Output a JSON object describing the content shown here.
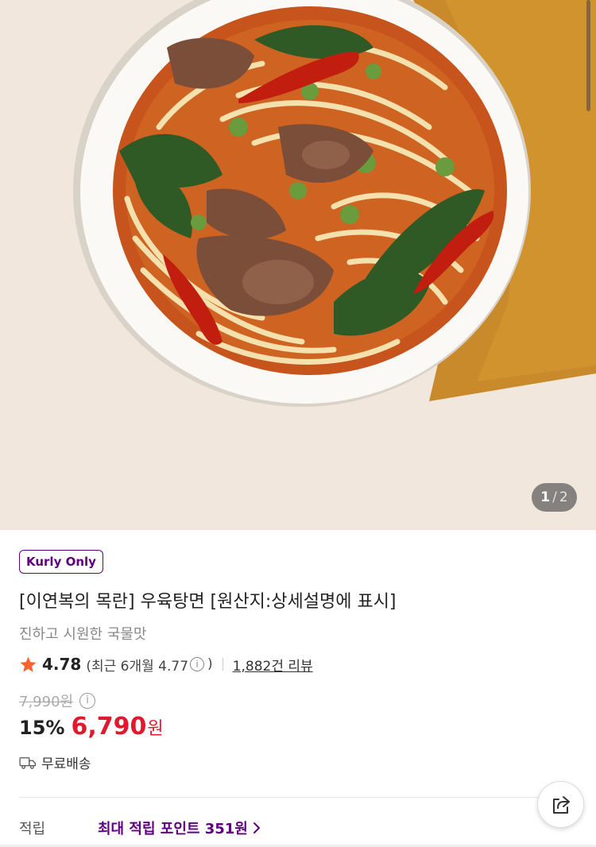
{
  "gallery": {
    "current": "1",
    "separator": "/",
    "total": "2",
    "image": "beef-noodle-soup-photo"
  },
  "product": {
    "badge": "Kurly Only",
    "title": "[이연복의 목란] 우육탕면 [원산지:상세설명에 표시]",
    "subtitle": "진하고 시원한 국물맛",
    "rating": "4.78",
    "recent_rating": "(최근 6개월 4.77",
    "recent_close": ")",
    "info_glyph": "i",
    "reviews": "1,882건 리뷰",
    "original_price": "7,990원",
    "discount": "15%",
    "price": "6,790",
    "currency": "원",
    "shipping": "무료배송"
  },
  "points": {
    "label": "적립",
    "link": "최대 적립 포인트 351원"
  },
  "colors": {
    "brand_purple": "#5f0080",
    "price_red": "#e0192f",
    "star_red": "#fa622f"
  },
  "icons": [
    "star-icon",
    "info-icon",
    "truck-icon",
    "chevron-right-icon",
    "share-icon"
  ]
}
